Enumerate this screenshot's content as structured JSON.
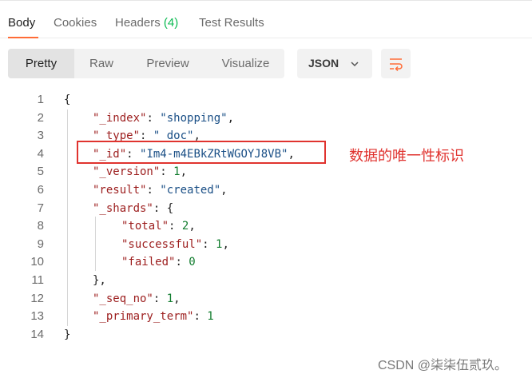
{
  "tabs": [
    {
      "label": "Body",
      "active": true
    },
    {
      "label": "Cookies",
      "active": false
    },
    {
      "label": "Headers",
      "count": "(4)",
      "active": false
    },
    {
      "label": "Test Results",
      "active": false
    }
  ],
  "view_modes": [
    "Pretty",
    "Raw",
    "Preview",
    "Visualize"
  ],
  "active_view": "Pretty",
  "format": "JSON",
  "icons": {
    "format_dropdown": "chevron-down-icon",
    "wrap": "wrap-lines-icon"
  },
  "colors": {
    "accent": "#ff6c37",
    "count": "#0cbb52",
    "annotation": "#e0332f"
  },
  "code": {
    "line_numbers": [
      "1",
      "2",
      "3",
      "4",
      "5",
      "6",
      "7",
      "8",
      "9",
      "10",
      "11",
      "12",
      "13",
      "14"
    ],
    "lines": [
      [
        {
          "t": "p",
          "v": "{"
        }
      ],
      [
        {
          "t": "k",
          "v": "\"_index\""
        },
        {
          "t": "p",
          "v": ": "
        },
        {
          "t": "s",
          "v": "\"shopping\""
        },
        {
          "t": "p",
          "v": ","
        }
      ],
      [
        {
          "t": "k",
          "v": "\"_type\""
        },
        {
          "t": "p",
          "v": ": "
        },
        {
          "t": "s",
          "v": "\"_doc\""
        },
        {
          "t": "p",
          "v": ","
        }
      ],
      [
        {
          "t": "k",
          "v": "\"_id\""
        },
        {
          "t": "p",
          "v": ": "
        },
        {
          "t": "s",
          "v": "\"Im4-m4EBkZRtWGOYJ8VB\""
        },
        {
          "t": "p",
          "v": ","
        }
      ],
      [
        {
          "t": "k",
          "v": "\"_version\""
        },
        {
          "t": "p",
          "v": ": "
        },
        {
          "t": "n",
          "v": "1"
        },
        {
          "t": "p",
          "v": ","
        }
      ],
      [
        {
          "t": "k",
          "v": "\"result\""
        },
        {
          "t": "p",
          "v": ": "
        },
        {
          "t": "s",
          "v": "\"created\""
        },
        {
          "t": "p",
          "v": ","
        }
      ],
      [
        {
          "t": "k",
          "v": "\"_shards\""
        },
        {
          "t": "p",
          "v": ": {"
        }
      ],
      [
        {
          "t": "k",
          "v": "\"total\""
        },
        {
          "t": "p",
          "v": ": "
        },
        {
          "t": "n",
          "v": "2"
        },
        {
          "t": "p",
          "v": ","
        }
      ],
      [
        {
          "t": "k",
          "v": "\"successful\""
        },
        {
          "t": "p",
          "v": ": "
        },
        {
          "t": "n",
          "v": "1"
        },
        {
          "t": "p",
          "v": ","
        }
      ],
      [
        {
          "t": "k",
          "v": "\"failed\""
        },
        {
          "t": "p",
          "v": ": "
        },
        {
          "t": "n",
          "v": "0"
        }
      ],
      [
        {
          "t": "p",
          "v": "},"
        }
      ],
      [
        {
          "t": "k",
          "v": "\"_seq_no\""
        },
        {
          "t": "p",
          "v": ": "
        },
        {
          "t": "n",
          "v": "1"
        },
        {
          "t": "p",
          "v": ","
        }
      ],
      [
        {
          "t": "k",
          "v": "\"_primary_term\""
        },
        {
          "t": "p",
          "v": ": "
        },
        {
          "t": "n",
          "v": "1"
        }
      ],
      [
        {
          "t": "p",
          "v": "}"
        }
      ]
    ]
  },
  "annotation": "数据的唯一性标识",
  "watermark": "CSDN @柒柒伍贰玖。"
}
